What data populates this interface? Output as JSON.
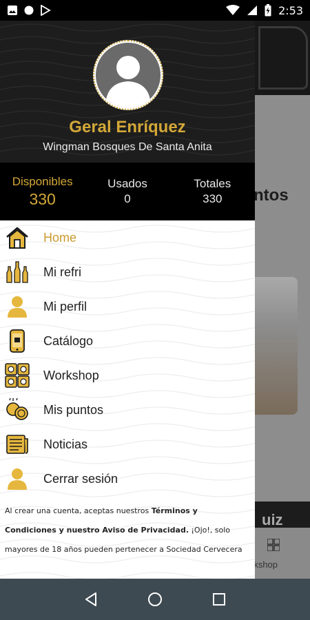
{
  "status_bar": {
    "time": "2:53"
  },
  "background": {
    "section_title": "ntos",
    "quiz_label": "uiz",
    "tab_label": "rkshop"
  },
  "drawer": {
    "user": {
      "name": "Geral Enríquez",
      "location": "Wingman Bosques De Santa Anita"
    },
    "stats": [
      {
        "label": "Disponibles",
        "value": "330",
        "active": true
      },
      {
        "label": "Usados",
        "value": "0",
        "active": false
      },
      {
        "label": "Totales",
        "value": "330",
        "active": false
      }
    ],
    "menu": [
      {
        "label": "Home",
        "icon": "home-icon",
        "active": true
      },
      {
        "label": "Mi refri",
        "icon": "bottles-icon",
        "active": false
      },
      {
        "label": "Mi perfil",
        "icon": "person-icon",
        "active": false
      },
      {
        "label": "Catálogo",
        "icon": "phone-icon",
        "active": false
      },
      {
        "label": "Workshop",
        "icon": "workshop-icon",
        "active": false
      },
      {
        "label": "Mis puntos",
        "icon": "coins-icon",
        "active": false
      },
      {
        "label": "Noticias",
        "icon": "newspaper-icon",
        "active": false
      },
      {
        "label": "Cerrar sesión",
        "icon": "logout-person-icon",
        "active": false
      }
    ],
    "legal": {
      "part1": "Al crear una cuenta, aceptas nuestros ",
      "bold": "Términos y Condiciones y nuestro Aviso de Privacidad.",
      "part2": " ¡Ojo!, solo mayores de 18 años pueden pertenecer a Sociedad Cervecera"
    }
  },
  "colors": {
    "accent": "#d4a838",
    "header_bg": "#1d1d1d",
    "nav_bg": "#3e4a52"
  }
}
